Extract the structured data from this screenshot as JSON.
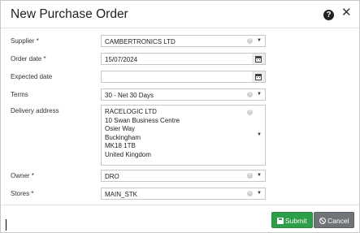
{
  "dialog": {
    "title": "New Purchase Order",
    "help_icon": "question-circle-icon",
    "close_icon": "close-icon"
  },
  "form": {
    "supplier": {
      "label": "Supplier *",
      "value": "CAMBERTRONICS LTD"
    },
    "order_date": {
      "label": "Order date *",
      "value": "15/07/2024"
    },
    "expected_date": {
      "label": "Expected date",
      "value": ""
    },
    "terms": {
      "label": "Terms",
      "value": "30 - Net 30 Days"
    },
    "delivery_address": {
      "label": "Delivery address",
      "lines": [
        "RACELOGIC LTD",
        "10 Swan Business Centre",
        "Osier Way",
        "Buckingham",
        "MK18 1TB",
        "United Kingdom"
      ]
    },
    "owner": {
      "label": "Owner *",
      "value": "DRO"
    },
    "stores": {
      "label": "Stores *",
      "value": "MAIN_STK"
    }
  },
  "buttons": {
    "submit": "Submit",
    "cancel": "Cancel"
  },
  "icons": {
    "clear": "clear-x-icon",
    "dropdown": "caret-down-icon",
    "calendar": "calendar-icon",
    "submit": "save-icon",
    "cancel": "ban-icon"
  },
  "colors": {
    "submit_bg": "#2e9e48",
    "cancel_bg": "#6f7478"
  }
}
